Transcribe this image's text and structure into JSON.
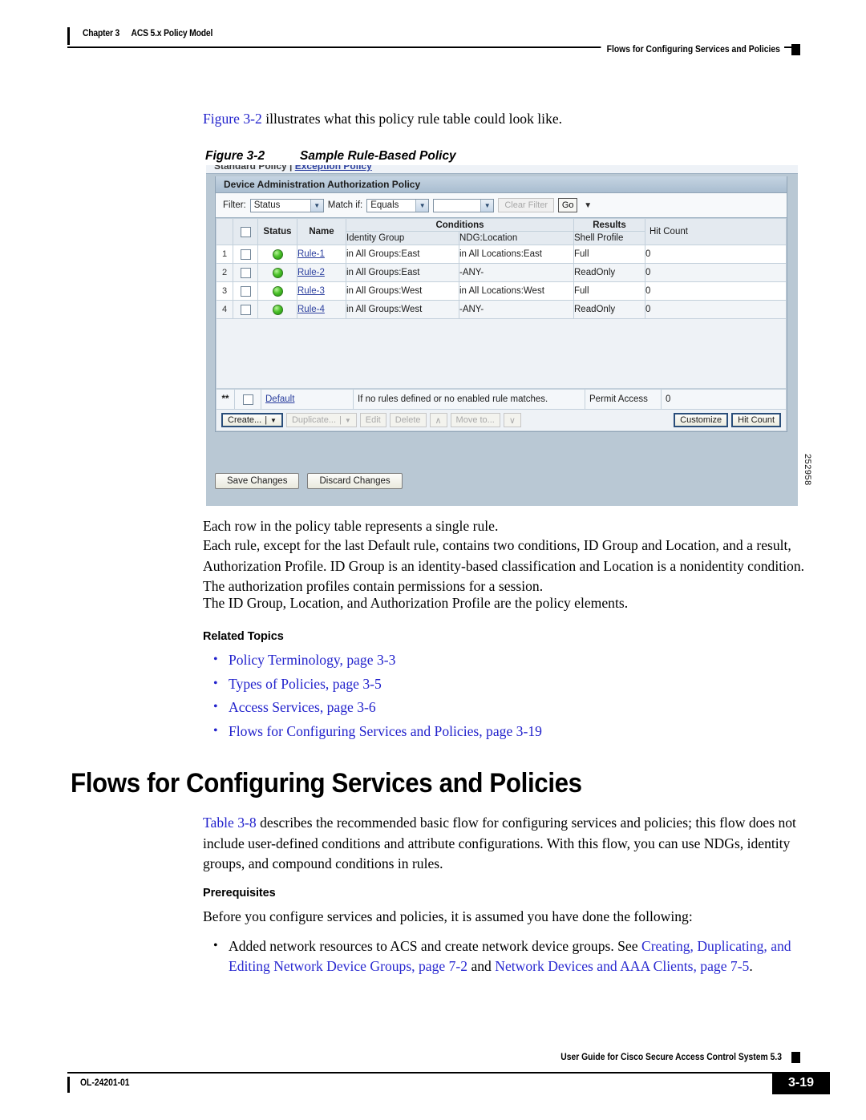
{
  "header": {
    "chapter_num": "Chapter 3",
    "chapter_title": "ACS 5.x Policy Model",
    "running_head": "Flows for Configuring Services and Policies"
  },
  "intro": {
    "link": "Figure 3-2",
    "rest": " illustrates what this policy rule table could look like."
  },
  "figure": {
    "number": "Figure 3-2",
    "title": "Sample Rule-Based Policy",
    "id_number": "252958",
    "clipped_tabs": {
      "standard": "Standard Policy",
      "separator": " | ",
      "exception": "Exception Policy"
    },
    "panel_title": "Device Administration Authorization Policy",
    "filter_bar": {
      "filter_label": "Filter:",
      "filter_value": "Status",
      "match_label": "Match if:",
      "match_value": "Equals",
      "value_value": "",
      "clear_filter": "Clear Filter",
      "go": "Go"
    },
    "table": {
      "group_headers": {
        "conditions": "Conditions",
        "results": "Results",
        "hit_count": "Hit Count"
      },
      "columns": {
        "status": "Status",
        "name": "Name",
        "identity_group": "Identity Group",
        "ndg_location": "NDG:Location",
        "shell_profile": "Shell Profile"
      },
      "rows": [
        {
          "num": "1",
          "name": "Rule-1",
          "identity_group": "in All Groups:East",
          "ndg_location": "in All Locations:East",
          "shell_profile": "Full",
          "hit_count": "0"
        },
        {
          "num": "2",
          "name": "Rule-2",
          "identity_group": "in All Groups:East",
          "ndg_location": "-ANY-",
          "shell_profile": "ReadOnly",
          "hit_count": "0"
        },
        {
          "num": "3",
          "name": "Rule-3",
          "identity_group": "in All Groups:West",
          "ndg_location": "in All Locations:West",
          "shell_profile": "Full",
          "hit_count": "0"
        },
        {
          "num": "4",
          "name": "Rule-4",
          "identity_group": "in All Groups:West",
          "ndg_location": "-ANY-",
          "shell_profile": "ReadOnly",
          "hit_count": "0"
        }
      ],
      "default_row": {
        "num": "**",
        "name": "Default",
        "description": "If no rules defined or no enabled rule matches.",
        "permission": "Permit Access",
        "hit_count": "0"
      }
    },
    "action_buttons": {
      "create": "Create...",
      "duplicate": "Duplicate...",
      "edit": "Edit",
      "delete": "Delete",
      "move_up": "∧",
      "move_to": "Move to...",
      "move_down": "∨",
      "customize": "Customize",
      "hit_count": "Hit Count"
    },
    "save_buttons": {
      "save": "Save Changes",
      "discard": "Discard Changes"
    }
  },
  "body": {
    "p1": "Each row in the policy table represents a single rule.",
    "p2": "Each rule, except for the last Default rule, contains two conditions, ID Group and Location, and a result, Authorization Profile. ID Group is an identity-based classification and Location is a nonidentity condition. The authorization profiles contain permissions for a session.",
    "p3": "The ID Group, Location, and Authorization Profile are the policy elements.",
    "related_topics_heading": "Related Topics",
    "related_topics": [
      "Policy Terminology, page 3-3",
      "Types of Policies, page 3-5",
      "Access Services, page 3-6",
      "Flows for Configuring Services and Policies, page 3-19"
    ]
  },
  "section": {
    "heading": "Flows for Configuring Services and Policies",
    "p1_link": "Table 3-8",
    "p1_rest": " describes the recommended basic flow for configuring services and policies; this flow does not include user-defined conditions and attribute configurations. With this flow, you can use NDGs, identity groups, and compound conditions in rules.",
    "prereq_heading": "Prerequisites",
    "prereq_intro": "Before you configure services and policies, it is assumed you have done the following:",
    "prereq_bullet": {
      "lead": "Added network resources to ACS and create network device groups. See ",
      "link1": "Creating, Duplicating, and Editing Network Device Groups, page 7-2",
      "mid": " and ",
      "link2": "Network Devices and AAA Clients, page 7-5",
      "end": "."
    }
  },
  "footer": {
    "guide": "User Guide for Cisco Secure Access Control System 5.3",
    "doc_id": "OL-24201-01",
    "page": "3-19"
  },
  "colors": {
    "link_blue": "#2222cc",
    "ui_link_blue": "#2b3f9e",
    "panel_header": "#b6c9da",
    "figure_bg": "#b9c8d4",
    "status_green": "#4cc22a"
  }
}
